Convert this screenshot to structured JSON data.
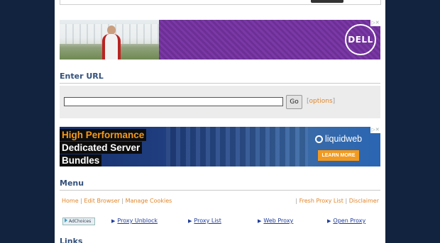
{
  "ads": {
    "ad1": {
      "brand": "DELL",
      "adchoice_icon": "adchoices-corner-icon"
    },
    "ad2": {
      "headline_lines": [
        "High Performance",
        "Dedicated Server",
        "Bundles"
      ],
      "brand": "liquidweb",
      "cta": "LEARN MORE",
      "colors": {
        "headline_highlight": "#0c0c0c",
        "cta": "#f39a1e"
      }
    }
  },
  "enter_url": {
    "title": "Enter URL",
    "input_value": "",
    "go_label": "Go",
    "options_open": "[",
    "options_label": "options",
    "options_close": "]"
  },
  "menu": {
    "title": "Menu",
    "left_items": [
      "Home",
      "Edit Browser",
      "Manage Cookies"
    ],
    "right_items": [
      "Fresh Proxy List",
      "Disclaimer"
    ],
    "separator": "|"
  },
  "links_bar": {
    "adchoices_label": "AdChoices",
    "items": [
      "Proxy Unblock",
      "Proxy List",
      "Web Proxy",
      "Open Proxy"
    ]
  },
  "links": {
    "title": "Links"
  },
  "colors": {
    "background": "#12233f",
    "heading": "#33507a",
    "link_orange": "#e0862b",
    "link_blue": "#1e3b9a",
    "dell_purple": "#7a39a6"
  }
}
